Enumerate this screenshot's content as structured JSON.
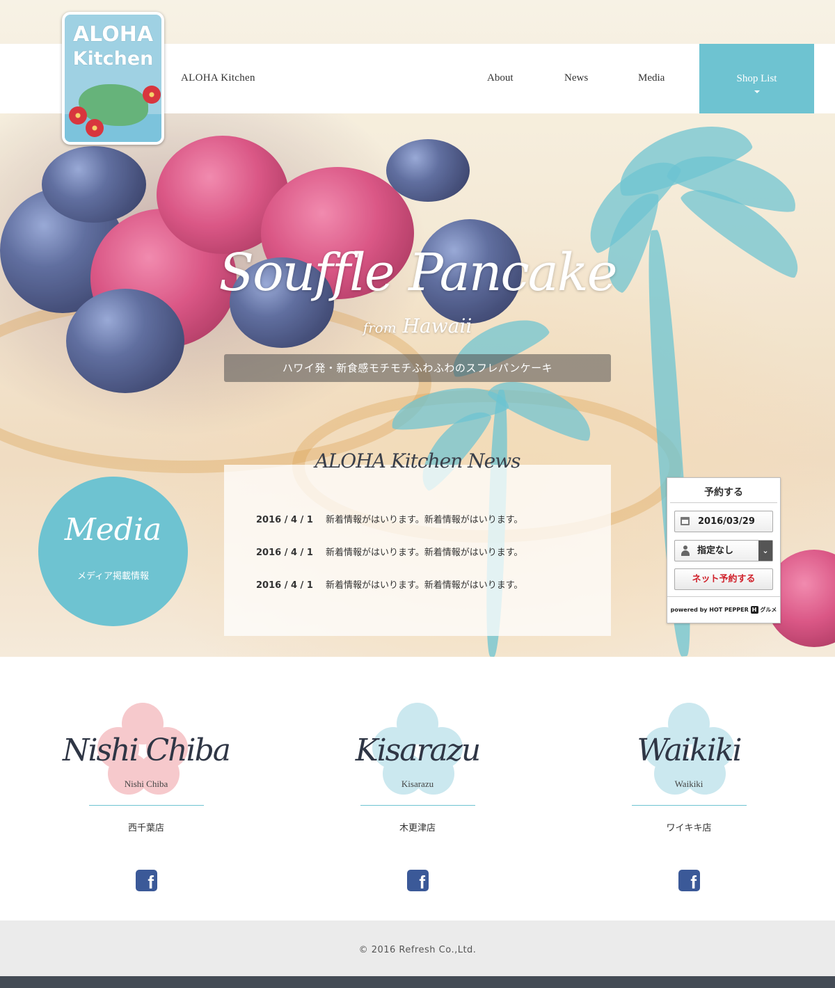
{
  "header": {
    "site_name": "ALOHA Kitchen",
    "nav": [
      {
        "label": "About"
      },
      {
        "label": "News"
      },
      {
        "label": "Media"
      }
    ],
    "shop_list_label": "Shop List"
  },
  "logo": {
    "line1": "ALOHA",
    "line2": "Kitchen"
  },
  "hero": {
    "title": "Souffle Pancake",
    "sub_from": "from",
    "sub_place": "Hawaii",
    "tagline": "ハワイ発・新食感モチモチふわふわのスフレパンケーキ"
  },
  "media": {
    "title": "Media",
    "subtitle": "メディア掲載情報"
  },
  "news": {
    "title": "ALOHA Kitchen News",
    "items": [
      {
        "date": "2016 / 4 / 1",
        "text": "新着情報がはいります。新着情報がはいります。"
      },
      {
        "date": "2016 / 4 / 1",
        "text": "新着情報がはいります。新着情報がはいります。"
      },
      {
        "date": "2016 / 4 / 1",
        "text": "新着情報がはいります。新着情報がはいります。"
      }
    ]
  },
  "reservation": {
    "title": "予約する",
    "date": "2016/03/29",
    "people": "指定なし",
    "submit": "ネット予約する",
    "powered_by": "powered by HOT PEPPER",
    "hp_mark": "H",
    "gourmet": "グルメ"
  },
  "shops": [
    {
      "script": "Nishi Chiba",
      "en": "Nishi Chiba",
      "ja": "西千葉店"
    },
    {
      "script": "Kisarazu",
      "en": "Kisarazu",
      "ja": "木更津店"
    },
    {
      "script": "Waikiki",
      "en": "Waikiki",
      "ja": "ワイキキ店"
    }
  ],
  "colors": {
    "accent": "#6ec3d1",
    "facebook": "#3b5998",
    "footer_bg": "#ebebeb",
    "footer_bar": "#444b55",
    "hibiscus_pink": "#f6c9cc",
    "hibiscus_blue": "#cbe8ef"
  },
  "icons": {
    "calendar": "calendar-icon",
    "person": "person-icon",
    "facebook": "facebook-icon",
    "caret": "chevron-down-icon"
  },
  "footer": {
    "copyright": "© 2016 Refresh Co.,Ltd."
  }
}
